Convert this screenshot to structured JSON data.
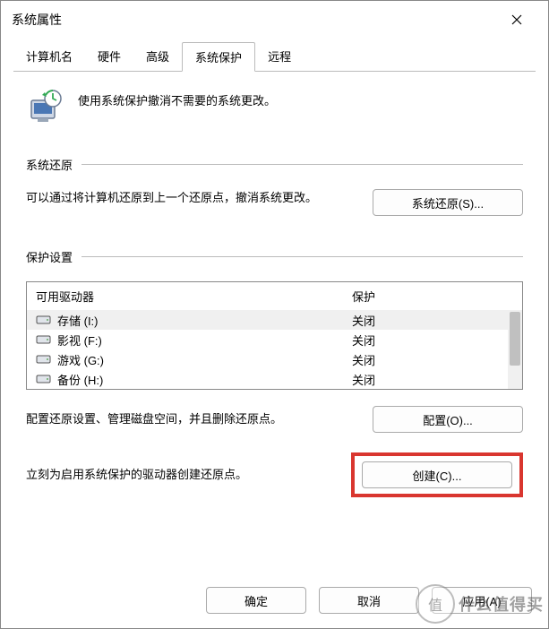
{
  "window": {
    "title": "系统属性"
  },
  "tabs": {
    "computer_name": "计算机名",
    "hardware": "硬件",
    "advanced": "高级",
    "system_protection": "系统保护",
    "remote": "远程"
  },
  "intro": "使用系统保护撤消不需要的系统更改。",
  "sections": {
    "restore": "系统还原",
    "protect": "保护设置"
  },
  "restore": {
    "desc": "可以通过将计算机还原到上一个还原点，撤消系统更改。",
    "button": "系统还原(S)..."
  },
  "drives": {
    "header_name": "可用驱动器",
    "header_prot": "保护",
    "rows": [
      {
        "name": "存储 (I:)",
        "prot": "关闭",
        "selected": true
      },
      {
        "name": "影视 (F:)",
        "prot": "关闭",
        "selected": false
      },
      {
        "name": "游戏 (G:)",
        "prot": "关闭",
        "selected": false
      },
      {
        "name": "备份 (H:)",
        "prot": "关闭",
        "selected": false
      }
    ]
  },
  "configure": {
    "desc": "配置还原设置、管理磁盘空间，并且删除还原点。",
    "button": "配置(O)..."
  },
  "create": {
    "desc": "立刻为启用系统保护的驱动器创建还原点。",
    "button": "创建(C)..."
  },
  "buttons": {
    "ok": "确定",
    "cancel": "取消",
    "apply": "应用(A)"
  },
  "watermark": {
    "circle": "值",
    "text": "什么值得买"
  }
}
